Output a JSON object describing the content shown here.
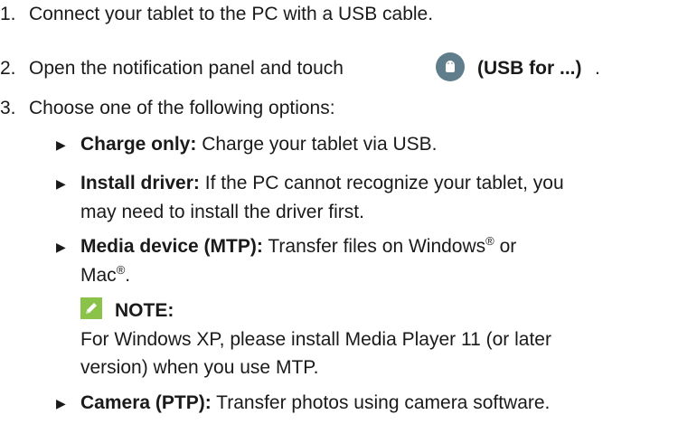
{
  "steps": [
    {
      "num": "1.",
      "text": "Connect your tablet to the PC with a USB cable."
    },
    {
      "num": "2.",
      "text_before": "Open the notification panel and touch",
      "text_bold": "(USB for ...)",
      "text_after": "."
    },
    {
      "num": "3.",
      "text": "Choose one of the following options:"
    }
  ],
  "options": [
    {
      "term": "Charge only:",
      "desc": "Charge your tablet via USB."
    },
    {
      "term": "Install driver:",
      "desc_line1": "If the PC cannot recognize your tablet, you",
      "desc_line2": "may need to install the driver first."
    },
    {
      "term": "Media device (MTP):",
      "desc_line1_a": "Transfer files on Windows",
      "reg": "®",
      "desc_line1_b": " or",
      "desc_line2_a": "Mac",
      "desc_line2_b": "."
    },
    {
      "term": "Camera (PTP):",
      "desc": "Transfer photos using camera software."
    }
  ],
  "note": {
    "heading": "NOTE:",
    "line1": "For Windows XP, please install Media Player 11 (or later",
    "line2": "version) when you use MTP.",
    "icon": "pencil-note-icon",
    "icon_color": "#8bc34a"
  },
  "usb_icon": {
    "name": "usb-notification-icon",
    "color": "#607d8b"
  },
  "bullet_glyph": "▶"
}
